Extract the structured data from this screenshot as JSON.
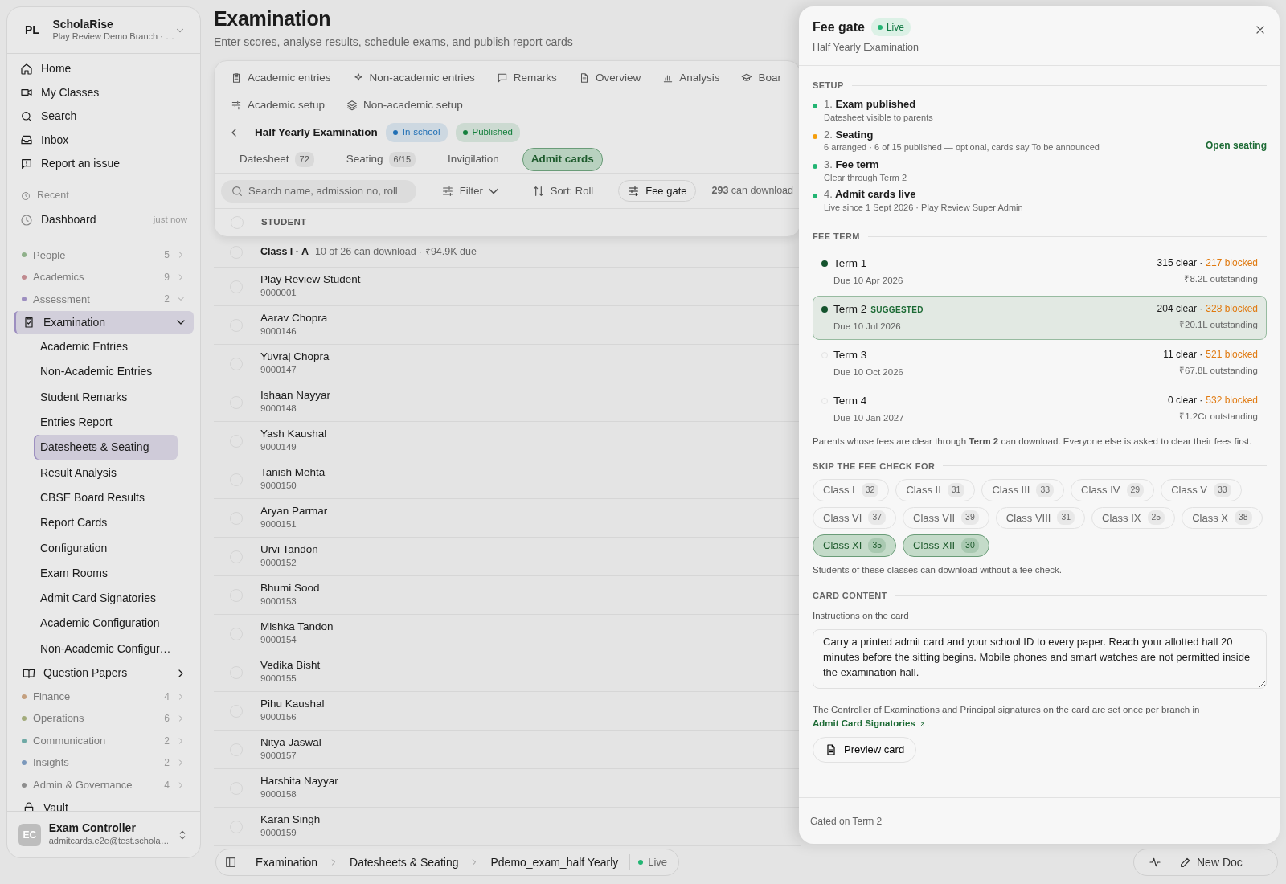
{
  "sidebar": {
    "brand": {
      "initials": "PL",
      "name": "ScholaRise",
      "subtitle": "Play Review Demo Branch · …"
    },
    "nav": [
      {
        "label": "Home"
      },
      {
        "label": "My Classes"
      },
      {
        "label": "Search"
      },
      {
        "label": "Inbox"
      },
      {
        "label": "Report an issue"
      }
    ],
    "recent": {
      "label": "Recent",
      "items": [
        {
          "label": "Dashboard",
          "time": "just now"
        }
      ]
    },
    "sections": [
      {
        "kind": "group",
        "label": "People",
        "count": "5",
        "color": "#8fb08a",
        "expanded": false
      },
      {
        "kind": "group",
        "label": "Academics",
        "count": "9",
        "color": "#c08a8f",
        "expanded": false
      },
      {
        "kind": "group",
        "label": "Assessment",
        "count": "2",
        "color": "#9d8fc0",
        "expanded": true
      },
      {
        "kind": "module",
        "label": "Examination",
        "selected": true,
        "expanded": true,
        "children": [
          {
            "label": "Academic Entries",
            "selected": false
          },
          {
            "label": "Non-Academic Entries",
            "selected": false
          },
          {
            "label": "Student Remarks",
            "selected": false
          },
          {
            "label": "Entries Report",
            "selected": false
          },
          {
            "label": "Datesheets & Seating",
            "selected": true
          },
          {
            "label": "Result Analysis",
            "selected": false
          },
          {
            "label": "CBSE Board Results",
            "selected": false
          },
          {
            "label": "Report Cards",
            "selected": false
          },
          {
            "label": "Configuration",
            "selected": false
          },
          {
            "label": "Exam Rooms",
            "selected": false
          },
          {
            "label": "Admit Card Signatories",
            "selected": false
          },
          {
            "label": "Academic Configuration",
            "selected": false
          },
          {
            "label": "Non-Academic Configur…",
            "selected": false
          }
        ]
      },
      {
        "kind": "module",
        "label": "Question Papers",
        "selected": false,
        "expanded": false
      },
      {
        "kind": "group",
        "label": "Finance",
        "count": "4",
        "color": "#c4a07f",
        "expanded": false
      },
      {
        "kind": "group",
        "label": "Operations",
        "count": "6",
        "color": "#a3ac7c",
        "expanded": false
      },
      {
        "kind": "group",
        "label": "Communication",
        "count": "2",
        "color": "#6fa9a5",
        "expanded": false
      },
      {
        "kind": "group",
        "label": "Insights",
        "count": "2",
        "color": "#7b98bb",
        "expanded": false
      },
      {
        "kind": "group",
        "label": "Admin & Governance",
        "count": "4",
        "color": "#8e8e8e",
        "expanded": false
      },
      {
        "kind": "module",
        "label": "Vault",
        "selected": false
      }
    ],
    "user": {
      "initials": "EC",
      "name": "Exam Controller",
      "email": "admitcards.e2e@test.schola…"
    }
  },
  "page": {
    "title": "Examination",
    "subtitle": "Enter scores, analyse results, schedule exams, and publish report cards"
  },
  "module_tabs": [
    {
      "label": "Academic entries"
    },
    {
      "label": "Non-academic entries"
    },
    {
      "label": "Remarks"
    },
    {
      "label": "Overview"
    },
    {
      "label": "Analysis"
    },
    {
      "label": "Boar"
    }
  ],
  "setup_tabs": [
    {
      "label": "Academic setup"
    },
    {
      "label": "Non-academic setup"
    }
  ],
  "exam": {
    "title": "Half Yearly Examination",
    "badges": [
      {
        "label": "In-school",
        "color": "#1f6fb5"
      },
      {
        "label": "Published",
        "color": "#15803d"
      }
    ]
  },
  "sub_tabs": [
    {
      "label": "Datesheet",
      "count": "72",
      "selected": false
    },
    {
      "label": "Seating",
      "count": "6/15",
      "selected": false
    },
    {
      "label": "Invigilation",
      "selected": false
    },
    {
      "label": "Admit cards",
      "selected": true
    }
  ],
  "toolbar": {
    "search": {
      "placeholder": "Search name, admission no, roll"
    },
    "filter": "Filter",
    "sort": "Sort: Roll",
    "fee_gate": "Fee gate",
    "download_count": "**293** can download"
  },
  "table": {
    "columns": [
      "STUDENT"
    ],
    "header_checked": false,
    "group": {
      "title": "Class I · A",
      "summary": "10 of 26 can download · ₹94.9K due",
      "checked": false
    },
    "rows": [
      {
        "name": "Play Review Student",
        "admission_no": "9000001",
        "checked": false
      },
      {
        "name": "Aarav Chopra",
        "admission_no": "9000146",
        "checked": false
      },
      {
        "name": "Yuvraj Chopra",
        "admission_no": "9000147",
        "checked": false
      },
      {
        "name": "Ishaan Nayyar",
        "admission_no": "9000148",
        "checked": false
      },
      {
        "name": "Yash Kaushal",
        "admission_no": "9000149",
        "checked": false
      },
      {
        "name": "Tanish Mehta",
        "admission_no": "9000150",
        "checked": false
      },
      {
        "name": "Aryan Parmar",
        "admission_no": "9000151",
        "checked": false
      },
      {
        "name": "Urvi Tandon",
        "admission_no": "9000152",
        "checked": false
      },
      {
        "name": "Bhumi Sood",
        "admission_no": "9000153",
        "checked": false
      },
      {
        "name": "Mishka Tandon",
        "admission_no": "9000154",
        "checked": false
      },
      {
        "name": "Vedika Bisht",
        "admission_no": "9000155",
        "checked": false
      },
      {
        "name": "Pihu Kaushal",
        "admission_no": "9000156",
        "checked": false
      },
      {
        "name": "Nitya Jaswal",
        "admission_no": "9000157",
        "checked": false
      },
      {
        "name": "Harshita Nayyar",
        "admission_no": "9000158",
        "checked": false
      },
      {
        "name": "Karan Singh",
        "admission_no": "9000159",
        "checked": false
      }
    ]
  },
  "breadcrumb": {
    "items": [
      "Examination",
      "Datesheets & Seating",
      "Pdemo_exam_half Yearly"
    ],
    "status": "Live"
  },
  "dock": {
    "new_doc": "New Doc"
  },
  "fee_gate": {
    "title": "Fee gate",
    "status": "Live",
    "subtitle": "Half Yearly Examination",
    "setup": {
      "heading": "SETUP",
      "steps": [
        {
          "number": "1.",
          "title": "Exam published",
          "detail": "Datesheet visible to parents",
          "color": "#22b573"
        },
        {
          "number": "2.",
          "title": "Seating",
          "detail": "6 arranged · 6 of 15 published — optional, cards say To be announced",
          "color": "#f59e0b",
          "action": "Open seating"
        },
        {
          "number": "3.",
          "title": "Fee term",
          "detail": "Clear through Term 2",
          "color": "#22b573"
        },
        {
          "number": "4.",
          "title": "Admit cards live",
          "detail": "Live since 1 Sept 2026 · Play Review Super Admin",
          "color": "#22b573"
        }
      ]
    },
    "fee_term": {
      "heading": "FEE TERM",
      "terms": [
        {
          "name": "Term 1",
          "due": "Due 10 Apr 2026",
          "clear": "315 clear ·",
          "blocked": "217 blocked",
          "outstanding": "₹8.2L outstanding",
          "included": true,
          "selected": false
        },
        {
          "name": "Term 2",
          "tag": "SUGGESTED",
          "due": "Due 10 Jul 2026",
          "clear": "204 clear ·",
          "blocked": "328 blocked",
          "outstanding": "₹20.1L outstanding",
          "included": true,
          "selected": true
        },
        {
          "name": "Term 3",
          "due": "Due 10 Oct 2026",
          "clear": "11 clear ·",
          "blocked": "521 blocked",
          "outstanding": "₹67.8L outstanding",
          "included": false,
          "selected": false
        },
        {
          "name": "Term 4",
          "due": "Due 10 Jan 2027",
          "clear": "0 clear ·",
          "blocked": "532 blocked",
          "outstanding": "₹1.2Cr outstanding",
          "included": false,
          "selected": false
        }
      ],
      "note": "Parents whose fees are clear through **Term 2** can download. Everyone else is asked to clear their fees first."
    },
    "skip": {
      "heading": "SKIP THE FEE CHECK FOR",
      "classes": [
        {
          "label": "Class I",
          "count": "32",
          "selected": false
        },
        {
          "label": "Class II",
          "count": "31",
          "selected": false
        },
        {
          "label": "Class III",
          "count": "33",
          "selected": false
        },
        {
          "label": "Class IV",
          "count": "29",
          "selected": false
        },
        {
          "label": "Class V",
          "count": "33",
          "selected": false
        },
        {
          "label": "Class VI",
          "count": "37",
          "selected": false
        },
        {
          "label": "Class VII",
          "count": "39",
          "selected": false
        },
        {
          "label": "Class VIII",
          "count": "31",
          "selected": false
        },
        {
          "label": "Class IX",
          "count": "25",
          "selected": false
        },
        {
          "label": "Class X",
          "count": "38",
          "selected": false
        },
        {
          "label": "Class XI",
          "count": "35",
          "selected": true
        },
        {
          "label": "Class XII",
          "count": "30",
          "selected": true
        }
      ],
      "note": "Students of these classes can download without a fee check."
    },
    "card_content": {
      "heading": "CARD CONTENT",
      "field_label": "Instructions on the card",
      "instructions": "Carry a printed admit card and your school ID to every paper. Reach your allotted hall 20 minutes before the sitting begins. Mobile phones and smart watches are not permitted inside the examination hall.",
      "signatories_note": "The Controller of Examinations and Principal signatures on the card are set once per branch in",
      "signatories_link": "Admit Card Signatories",
      "signatories_after": ".",
      "preview": "Preview card"
    },
    "footer": "Gated on Term 2"
  }
}
